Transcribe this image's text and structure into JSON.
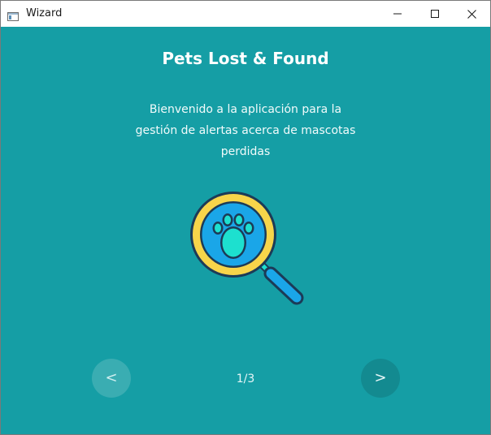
{
  "window": {
    "title": "Wizard",
    "icon": "app-window-icon",
    "controls": {
      "minimize_icon": "minimize-icon",
      "maximize_icon": "maximize-icon",
      "close_icon": "close-icon"
    }
  },
  "wizard": {
    "heading": "Pets Lost & Found",
    "description": "Bienvenido a la aplicación para la gestión de alertas acerca de mascotas perdidas",
    "illustration_icon": "magnifier-paw-icon",
    "prev_label": "<",
    "next_label": ">",
    "page_indicator": "1/3"
  },
  "colors": {
    "background": "#159ea5",
    "prev_button": "#3aadb2",
    "next_button": "#138a90",
    "lens_ring": "#f7d54a",
    "lens_fill": "#1aa6e8",
    "paw": "#1de0cf",
    "outline": "#1c3b57"
  }
}
